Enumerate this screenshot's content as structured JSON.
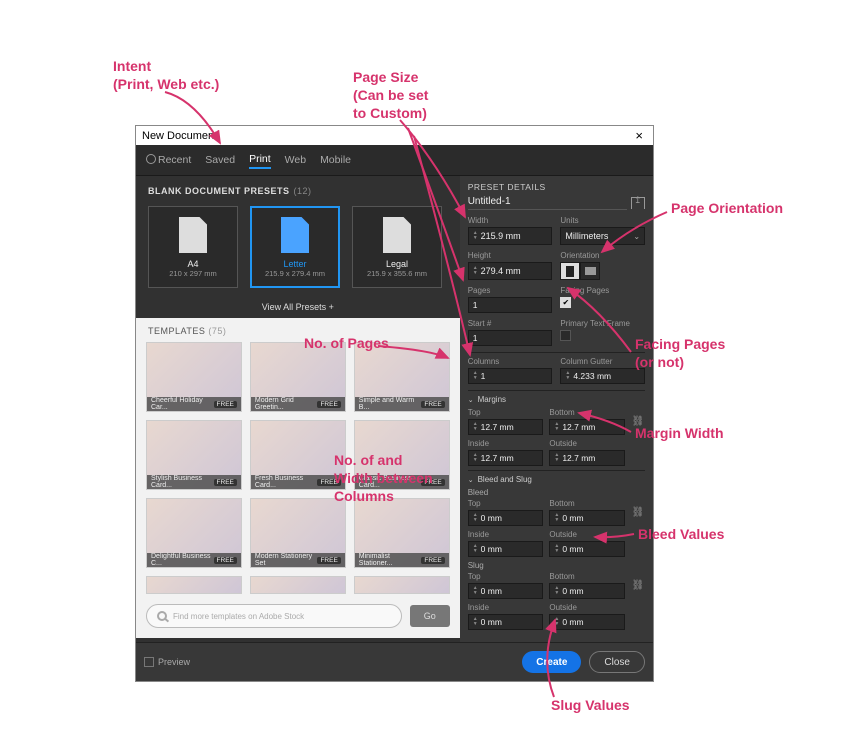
{
  "annotations": {
    "intent1": "Intent",
    "intent2": "(Print, Web etc.)",
    "pagesize1": "Page Size",
    "pagesize2": "(Can be set",
    "pagesize3": "to Custom)",
    "pageorientation": "Page Orientation",
    "nopages": "No. of Pages",
    "facingpages1": "Facing Pages",
    "facingpages2": "(or not)",
    "columns1": "No. of and",
    "columns2": "Width between",
    "columns3": "Columns",
    "marginwidth": "Margin Width",
    "bleedvalues": "Bleed Values",
    "slugvalues": "Slug Values"
  },
  "dialog": {
    "title": "New Document",
    "close": "×",
    "tabs": {
      "recent": "Recent",
      "saved": "Saved",
      "print": "Print",
      "web": "Web",
      "mobile": "Mobile"
    },
    "presetsHeading": "BLANK DOCUMENT PRESETS",
    "presetsCount": "(12)",
    "presets": [
      {
        "name": "A4",
        "dim": "210 x 297 mm"
      },
      {
        "name": "Letter",
        "dim": "215.9 x 279.4 mm"
      },
      {
        "name": "Legal",
        "dim": "215.9 x 355.6 mm"
      }
    ],
    "viewAll": "View All Presets +",
    "templatesHeading": "TEMPLATES",
    "templatesCount": "(75)",
    "templates": [
      {
        "name": "Cheerful Holiday Car...",
        "badge": "FREE"
      },
      {
        "name": "Modern Grid Greetin...",
        "badge": "FREE"
      },
      {
        "name": "Simple and Warm B...",
        "badge": "FREE"
      },
      {
        "name": "Stylish Business Card...",
        "badge": "FREE"
      },
      {
        "name": "Fresh Business Card...",
        "badge": "FREE"
      },
      {
        "name": "Classic Business Card...",
        "badge": "FREE"
      },
      {
        "name": "Delightful Business C...",
        "badge": "FREE"
      },
      {
        "name": "Modern Stationery Set",
        "badge": "FREE"
      },
      {
        "name": "Minimalist Stationer...",
        "badge": "FREE"
      }
    ],
    "searchPlaceholder": "Find more templates on Adobe Stock",
    "goLabel": "Go"
  },
  "details": {
    "heading": "PRESET DETAILS",
    "docname": "Untitled-1",
    "labels": {
      "width": "Width",
      "units": "Units",
      "height": "Height",
      "orientation": "Orientation",
      "pages": "Pages",
      "facingPages": "Facing Pages",
      "start": "Start #",
      "ptf": "Primary Text Frame",
      "columns": "Columns",
      "gutter": "Column Gutter",
      "margins": "Margins",
      "top": "Top",
      "bottom": "Bottom",
      "inside": "Inside",
      "outside": "Outside",
      "bleedslug": "Bleed and Slug",
      "bleed": "Bleed",
      "slug": "Slug"
    },
    "values": {
      "width": "215.9 mm",
      "units": "Millimeters",
      "height": "279.4 mm",
      "pages": "1",
      "start": "1",
      "columns": "1",
      "gutter": "4.233 mm",
      "marginTop": "12.7 mm",
      "marginBottom": "12.7 mm",
      "marginInside": "12.7 mm",
      "marginOutside": "12.7 mm",
      "bleedTop": "0 mm",
      "bleedBottom": "0 mm",
      "bleedInside": "0 mm",
      "bleedOutside": "0 mm",
      "slugTop": "0 mm",
      "slugBottom": "0 mm",
      "slugInside": "0 mm",
      "slugOutside": "0 mm"
    },
    "check": "✔"
  },
  "footer": {
    "preview": "Preview",
    "create": "Create",
    "close": "Close"
  }
}
